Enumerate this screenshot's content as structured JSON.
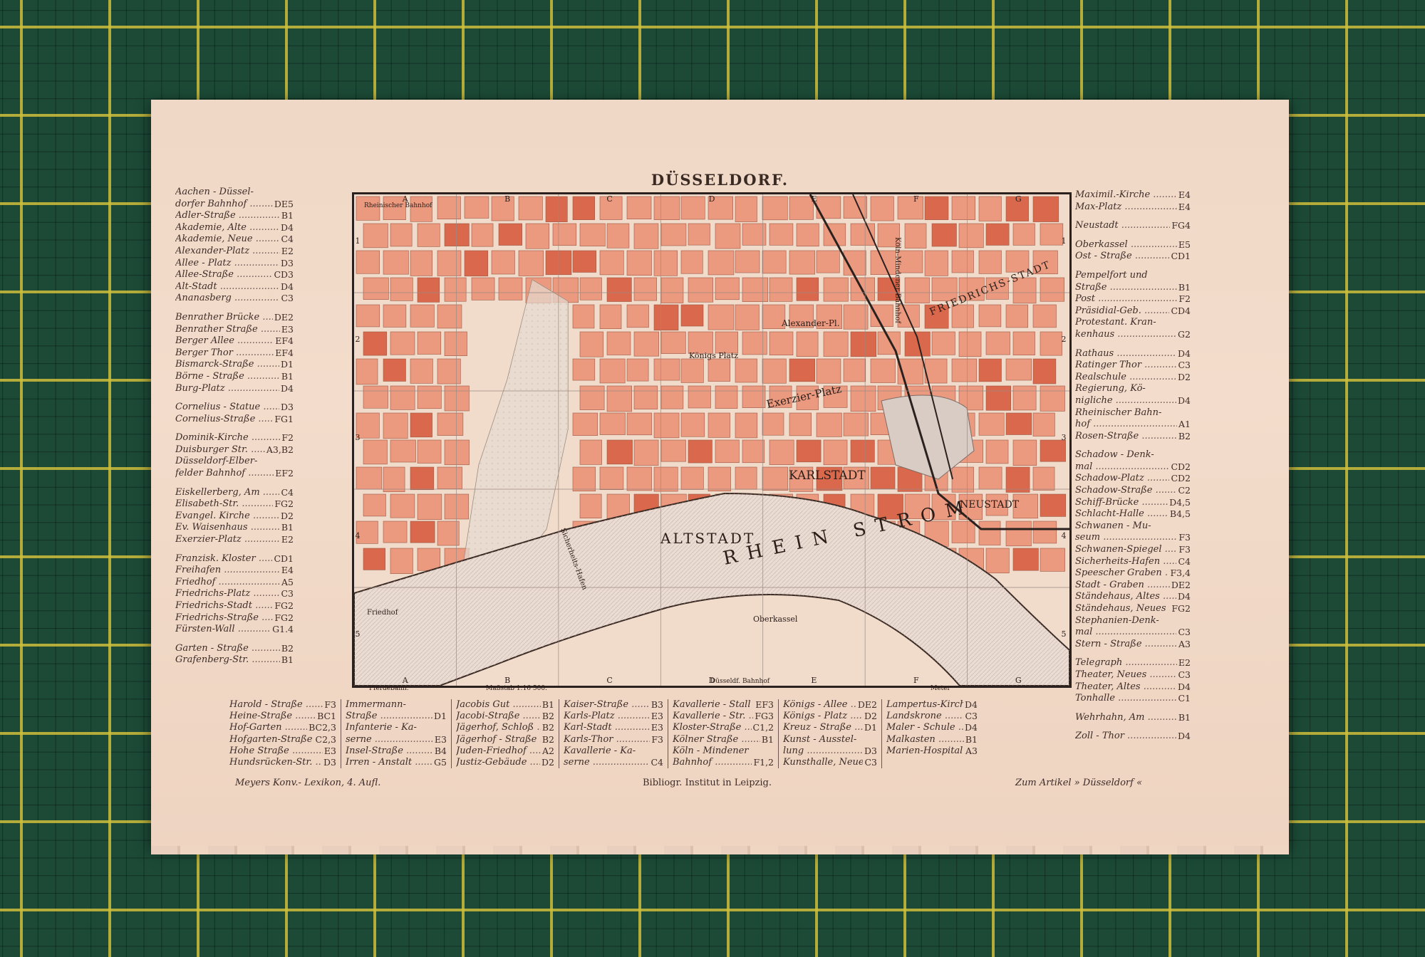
{
  "title": "DÜSSELDORF.",
  "left_index": [
    [
      {
        "n": "Aachen - Düssel-",
        "c": ""
      },
      {
        "n": "dorfer Bahnhof",
        "c": "DE5"
      },
      {
        "n": "Adler-Straße",
        "c": "B1"
      },
      {
        "n": "Akademie, Alte",
        "c": "D4"
      },
      {
        "n": "Akademie, Neue",
        "c": "C4"
      },
      {
        "n": "Alexander-Platz",
        "c": "E2"
      },
      {
        "n": "Allee - Platz",
        "c": "D3"
      },
      {
        "n": "Allee-Straße",
        "c": "CD3"
      },
      {
        "n": "Alt-Stadt",
        "c": "D4"
      },
      {
        "n": "Ananasberg",
        "c": "C3"
      }
    ],
    [
      {
        "n": "Benrather Brücke",
        "c": "DE2"
      },
      {
        "n": "Benrather Straße",
        "c": "E3"
      },
      {
        "n": "Berger Allee",
        "c": "EF4"
      },
      {
        "n": "Berger Thor",
        "c": "EF4"
      },
      {
        "n": "Bismarck-Straße",
        "c": "D1"
      },
      {
        "n": "Börne - Straße",
        "c": "B1"
      },
      {
        "n": "Burg-Platz",
        "c": "D4"
      }
    ],
    [
      {
        "n": "Cornelius - Statue",
        "c": "D3"
      },
      {
        "n": "Cornelius-Straße",
        "c": "FG1"
      }
    ],
    [
      {
        "n": "Dominik-Kirche",
        "c": "F2"
      },
      {
        "n": "Duisburger Str.",
        "c": "A3,B2"
      },
      {
        "n": "Düsseldorf-Elber-",
        "c": ""
      },
      {
        "n": "felder Bahnhof",
        "c": "EF2"
      }
    ],
    [
      {
        "n": "Eiskellerberg, Am",
        "c": "C4"
      },
      {
        "n": "Elisabeth-Str.",
        "c": "FG2"
      },
      {
        "n": "Evangel. Kirche",
        "c": "D2"
      },
      {
        "n": "Ev. Waisenhaus",
        "c": "B1"
      },
      {
        "n": "Exerzier-Platz",
        "c": "E2"
      }
    ],
    [
      {
        "n": "Franzisk. Kloster",
        "c": "CD1"
      },
      {
        "n": "Freihafen",
        "c": "E4"
      },
      {
        "n": "Friedhof",
        "c": "A5"
      },
      {
        "n": "Friedrichs-Platz",
        "c": "C3"
      },
      {
        "n": "Friedrichs-Stadt",
        "c": "FG2"
      },
      {
        "n": "Friedrichs-Straße",
        "c": "FG2"
      },
      {
        "n": "Fürsten-Wall",
        "c": "G1.4"
      }
    ],
    [
      {
        "n": "Garten - Straße",
        "c": "B2"
      },
      {
        "n": "Grafenberg-Str.",
        "c": "B1"
      }
    ]
  ],
  "right_index": [
    [
      {
        "n": "Maximil.-Kirche",
        "c": "E4"
      },
      {
        "n": "Max-Platz",
        "c": "E4"
      }
    ],
    [
      {
        "n": "Neustadt",
        "c": "FG4"
      }
    ],
    [
      {
        "n": "Oberkassel",
        "c": "E5"
      },
      {
        "n": "Ost - Straße",
        "c": "CD1"
      }
    ],
    [
      {
        "n": "Pempelfort und",
        "c": ""
      },
      {
        "n": "Straße",
        "c": "B1"
      },
      {
        "n": "Post",
        "c": "F2"
      },
      {
        "n": "Präsidial-Geb.",
        "c": "CD4"
      },
      {
        "n": "Protestant. Kran-",
        "c": ""
      },
      {
        "n": "kenhaus",
        "c": "G2"
      }
    ],
    [
      {
        "n": "Rathaus",
        "c": "D4"
      },
      {
        "n": "Ratinger Thor",
        "c": "C3"
      },
      {
        "n": "Realschule",
        "c": "D2"
      },
      {
        "n": "Regierung, Kö-",
        "c": ""
      },
      {
        "n": "nigliche",
        "c": "D4"
      },
      {
        "n": "Rheinischer Bahn-",
        "c": ""
      },
      {
        "n": "hof",
        "c": "A1"
      },
      {
        "n": "Rosen-Straße",
        "c": "B2"
      }
    ],
    [
      {
        "n": "Schadow - Denk-",
        "c": ""
      },
      {
        "n": "mal",
        "c": "CD2"
      },
      {
        "n": "Schadow-Platz",
        "c": "CD2"
      },
      {
        "n": "Schadow-Straße",
        "c": "C2"
      },
      {
        "n": "Schiff-Brücke",
        "c": "D4,5"
      },
      {
        "n": "Schlacht-Halle",
        "c": "B4,5"
      },
      {
        "n": "Schwanen - Mu-",
        "c": ""
      },
      {
        "n": "seum",
        "c": "F3"
      },
      {
        "n": "Schwanen-Spiegel",
        "c": "F3"
      },
      {
        "n": "Sicherheits-Hafen",
        "c": "C4"
      },
      {
        "n": "Speescher Graben",
        "c": "F3,4"
      },
      {
        "n": "Stadt - Graben",
        "c": "DE2"
      },
      {
        "n": "Ständehaus, Altes",
        "c": "D4"
      },
      {
        "n": "Ständehaus, Neues",
        "c": "FG2"
      },
      {
        "n": "Stephanien-Denk-",
        "c": ""
      },
      {
        "n": "mal",
        "c": "C3"
      },
      {
        "n": "Stern - Straße",
        "c": "A3"
      }
    ],
    [
      {
        "n": "Telegraph",
        "c": "E2"
      },
      {
        "n": "Theater, Neues",
        "c": "C3"
      },
      {
        "n": "Theater, Altes",
        "c": "D4"
      },
      {
        "n": "Tonhalle",
        "c": "C1"
      }
    ],
    [
      {
        "n": "Wehrhahn, Am",
        "c": "B1"
      }
    ],
    [
      {
        "n": "Zoll - Thor",
        "c": "D4"
      }
    ]
  ],
  "bottom_index": [
    [
      {
        "n": "Harold - Straße",
        "c": "F3"
      },
      {
        "n": "Heine-Straße",
        "c": "BC1"
      },
      {
        "n": "Hof-Garten",
        "c": "BC2,3"
      },
      {
        "n": "Hofgarten-Straße",
        "c": "C2,3"
      },
      {
        "n": "Hohe Straße",
        "c": "E3"
      },
      {
        "n": "Hundsrücken-Str.",
        "c": "D3"
      }
    ],
    [
      {
        "n": "Immermann-",
        "c": ""
      },
      {
        "n": "Straße",
        "c": "D1"
      },
      {
        "n": "Infanterie - Ka-",
        "c": ""
      },
      {
        "n": "serne",
        "c": "E3"
      },
      {
        "n": "Insel-Straße",
        "c": "B4"
      },
      {
        "n": "Irren - Anstalt",
        "c": "G5"
      }
    ],
    [
      {
        "n": "Jacobis Gut",
        "c": "B1"
      },
      {
        "n": "Jacobi-Straße",
        "c": "B2"
      },
      {
        "n": "Jägerhof, Schloß",
        "c": "B2"
      },
      {
        "n": "Jägerhof - Straße",
        "c": "B2"
      },
      {
        "n": "Juden-Friedhof",
        "c": "A2"
      },
      {
        "n": "Justiz-Gebäude",
        "c": "D2"
      }
    ],
    [
      {
        "n": "Kaiser-Straße",
        "c": "B3"
      },
      {
        "n": "Karls-Platz",
        "c": "E3"
      },
      {
        "n": "Karl-Stadt",
        "c": "E3"
      },
      {
        "n": "Karls-Thor",
        "c": "F3"
      },
      {
        "n": "Kavallerie - Ka-",
        "c": ""
      },
      {
        "n": "serne",
        "c": "C4"
      }
    ],
    [
      {
        "n": "Kavallerie - Stall",
        "c": "EF3"
      },
      {
        "n": "Kavallerie - Str.",
        "c": "FG3"
      },
      {
        "n": "Kloster-Straße",
        "c": "C1,2"
      },
      {
        "n": "Kölner Straße",
        "c": "B1"
      },
      {
        "n": "Köln - Mindener",
        "c": ""
      },
      {
        "n": "Bahnhof",
        "c": "F1,2"
      }
    ],
    [
      {
        "n": "Königs - Allee",
        "c": "DE2"
      },
      {
        "n": "Königs - Platz",
        "c": "D2"
      },
      {
        "n": "Kreuz - Straße",
        "c": "D1"
      },
      {
        "n": "Kunst - Ausstel-",
        "c": ""
      },
      {
        "n": "lung",
        "c": "D3"
      },
      {
        "n": "Kunsthalle, Neue",
        "c": "C3"
      }
    ],
    [
      {
        "n": "Lampertus-Kirche",
        "c": "D4"
      },
      {
        "n": "Landskrone",
        "c": "C3"
      },
      {
        "n": "",
        "c": ""
      },
      {
        "n": "Maler - Schule",
        "c": "D4"
      },
      {
        "n": "Malkasten",
        "c": "B1"
      },
      {
        "n": "Marien-Hospital",
        "c": "A3"
      }
    ]
  ],
  "footer": {
    "left": "Meyers Konv.- Lexikon, 4. Aufl.",
    "center": "Bibliogr. Institut in Leipzig.",
    "right": "Zum Artikel » Düsseldorf «"
  },
  "map": {
    "grid_cols": [
      "A",
      "B",
      "C",
      "D",
      "E",
      "F",
      "G"
    ],
    "grid_rows": [
      "1",
      "2",
      "3",
      "4",
      "5"
    ],
    "river_label": "RHEIN STROM",
    "district_labels": [
      "KARLSTADT",
      "ALTSTADT",
      "NEUSTADT",
      "FRIEDRICHS-STADT",
      "Exerzier-Platz",
      "Königs Platz",
      "Alexander-Pl.",
      "Oberkassel",
      "Sicherheits-Hafen",
      "Friedhof",
      "Rheinischer Bahnhof",
      "Köln-Mindener Bahnhof"
    ],
    "scale_left": "Pferdebahn.",
    "scale_center": "Maßstab 1:16 500.",
    "scale_right": "Meter",
    "bottom_station": "Düsseldf. Bahnhof",
    "colors": {
      "block": "#ec9a7f",
      "block_dark": "#d9684c",
      "street": "#f6e4d6",
      "river": "#e9d6cc",
      "park": "#e5ddd6",
      "frame": "#2b211e"
    }
  }
}
